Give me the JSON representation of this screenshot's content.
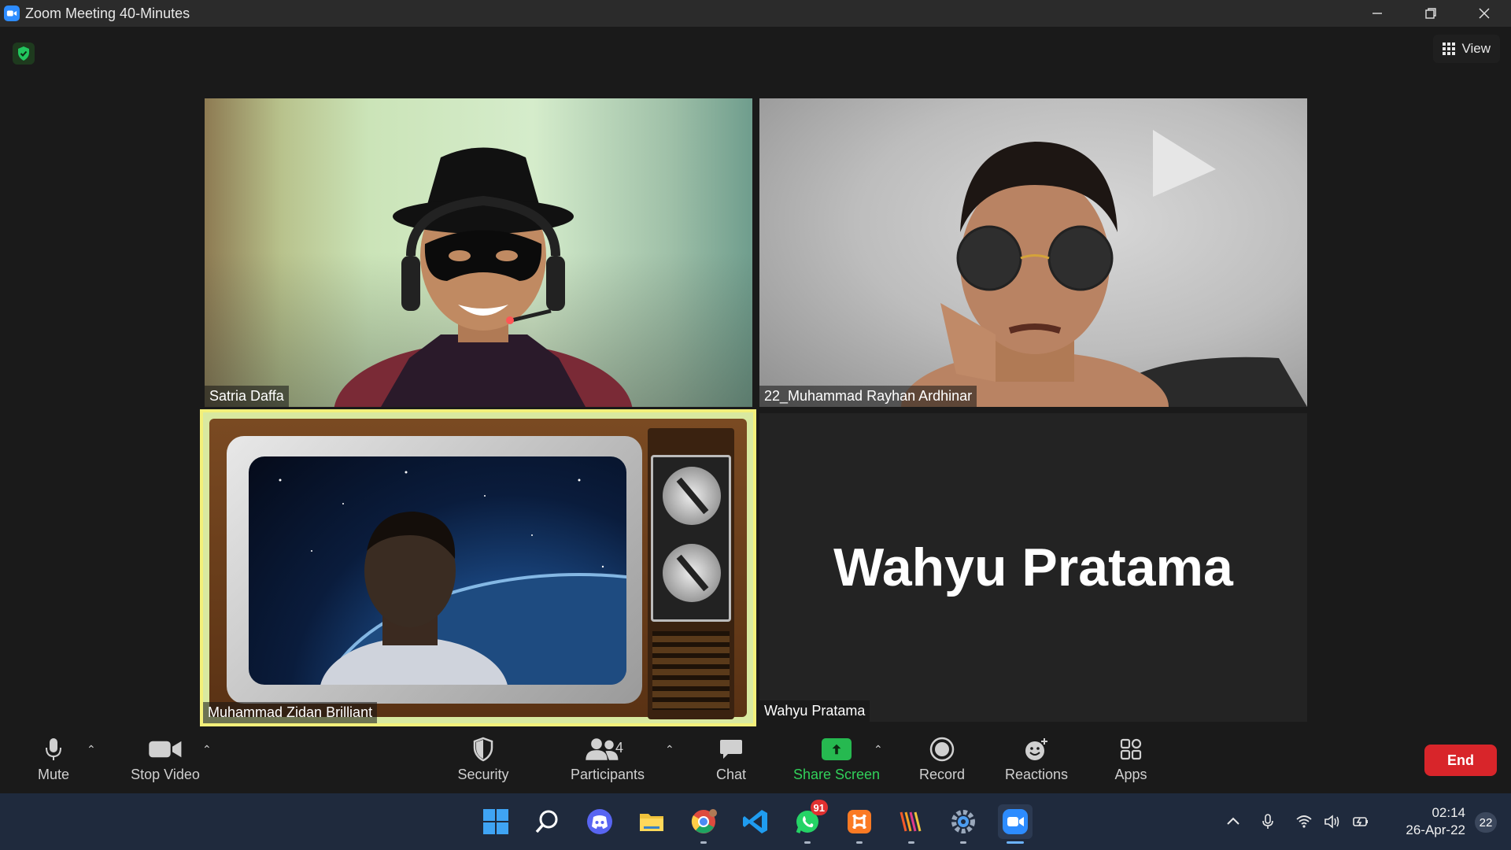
{
  "window": {
    "title": "Zoom Meeting 40-Minutes"
  },
  "top_right": {
    "view_label": "View"
  },
  "participants": [
    {
      "name": "Satria Daffa"
    },
    {
      "name": "22_Muhammad Rayhan Ardhinar"
    },
    {
      "name": "Muhammad Zidan Brilliant"
    },
    {
      "name": "Wahyu Pratama",
      "display_name": "Wahyu Pratama"
    }
  ],
  "toolbar": {
    "mute_label": "Mute",
    "stop_video_label": "Stop Video",
    "security_label": "Security",
    "participants_label": "Participants",
    "participants_count": "4",
    "chat_label": "Chat",
    "share_screen_label": "Share Screen",
    "record_label": "Record",
    "reactions_label": "Reactions",
    "apps_label": "Apps",
    "end_label": "End"
  },
  "taskbar": {
    "whatsapp_badge": "91",
    "time": "02:14",
    "date": "26-Apr-22",
    "notification_count": "22"
  },
  "colors": {
    "accent_green": "#31d05a",
    "end_red": "#d8252a",
    "active_speaker": "#f3f07a"
  }
}
